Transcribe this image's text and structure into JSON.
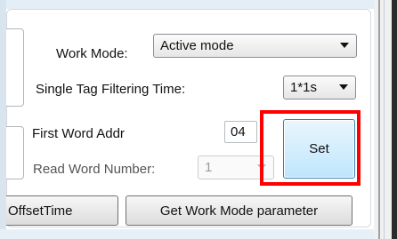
{
  "work_mode": {
    "label": "Work Mode:",
    "value": "Active mode"
  },
  "single_tag_filtering": {
    "label": "Single Tag Filtering Time:",
    "value": "1*1s"
  },
  "first_word_addr": {
    "label": "First Word Addr",
    "value": "04"
  },
  "read_word_number": {
    "label": "Read Word Number:",
    "value": "1"
  },
  "buttons": {
    "set": "Set",
    "offset_time": "OffsetTime",
    "get_work_mode_parameter": "Get Work Mode parameter"
  },
  "annotation": {
    "color": "#ff0000"
  }
}
